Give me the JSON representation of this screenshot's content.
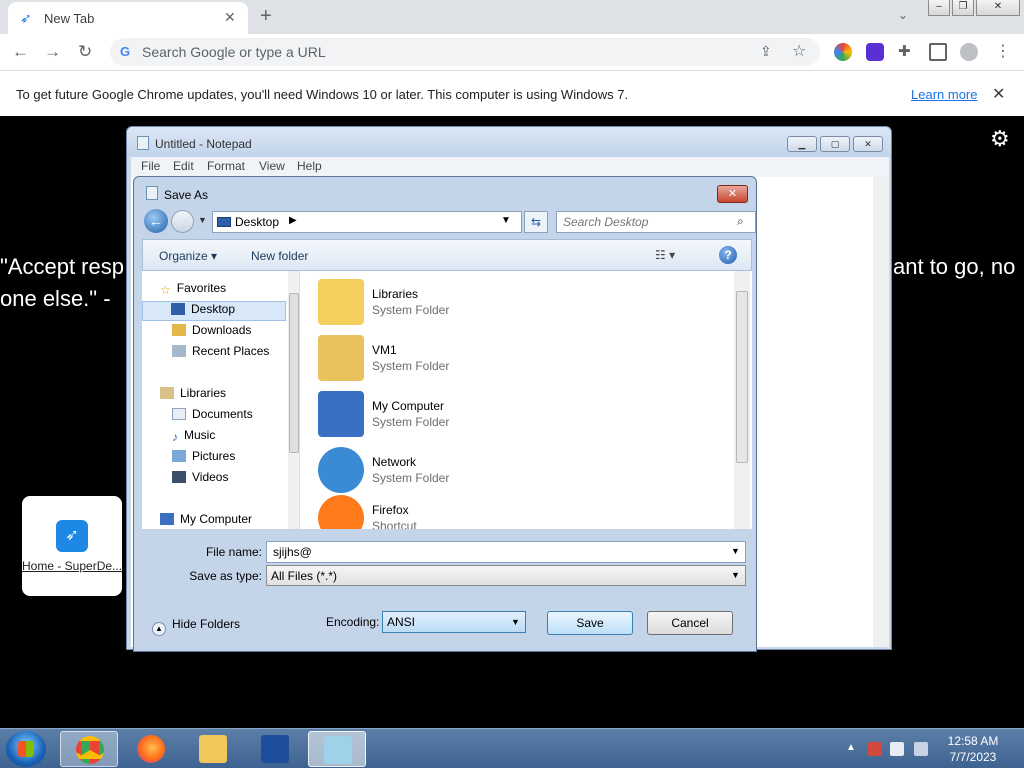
{
  "browser": {
    "tab_title": "New Tab",
    "omnibox_placeholder": "Search Google or type a URL",
    "infobar_message": "To get future Google Chrome updates, you'll need Windows 10 or later. This computer is using Windows 7.",
    "infobar_link": "Learn more"
  },
  "page": {
    "quote_line1": "\"Accept resp",
    "quote_line2": "one else.\" -",
    "quote_right": "ant to go, no",
    "shortcut_label": "Home - SuperDe..."
  },
  "notepad": {
    "title": "Untitled - Notepad",
    "menu": [
      "File",
      "Edit",
      "Format",
      "View",
      "Help"
    ]
  },
  "saveas": {
    "title": "Save As",
    "location": "Desktop",
    "search_placeholder": "Search Desktop",
    "organize": "Organize ▾",
    "new_folder": "New folder",
    "nav": {
      "favorites": "Favorites",
      "desktop": "Desktop",
      "downloads": "Downloads",
      "recent": "Recent Places",
      "libraries": "Libraries",
      "documents": "Documents",
      "music": "Music",
      "pictures": "Pictures",
      "videos": "Videos",
      "computer": "My Computer"
    },
    "files": [
      {
        "name": "Libraries",
        "type": "System Folder",
        "color": "#f3cf5d"
      },
      {
        "name": "VM1",
        "type": "System Folder",
        "color": "#e8c25a"
      },
      {
        "name": "My Computer",
        "type": "System Folder",
        "color": "#3b6fc2"
      },
      {
        "name": "Network",
        "type": "System Folder",
        "color": "#3a8ad6"
      },
      {
        "name": "Firefox",
        "type": "Shortcut",
        "color": "#ff7a1a"
      }
    ],
    "file_name_label": "File name:",
    "file_name_value": "sjijhs@",
    "save_type_label": "Save as type:",
    "save_type_value": "All Files  (*.*)",
    "hide_folders": "Hide Folders",
    "encoding_label": "Encoding:",
    "encoding_value": "ANSI",
    "save": "Save",
    "cancel": "Cancel"
  },
  "taskbar": {
    "time": "12:58 AM",
    "date": "7/7/2023"
  }
}
